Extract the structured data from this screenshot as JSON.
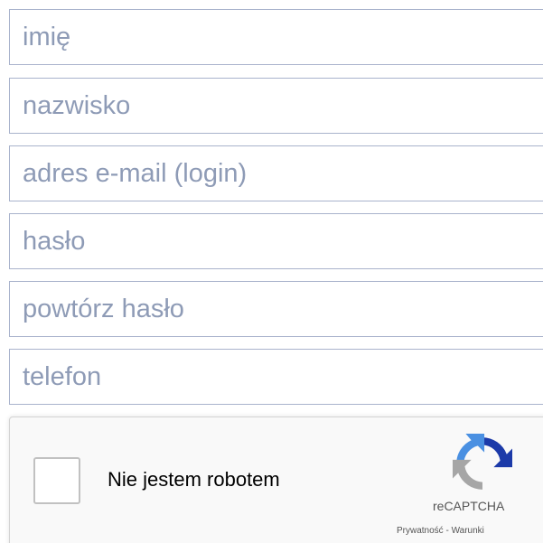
{
  "form": {
    "fields": [
      {
        "placeholder": "imię",
        "value": ""
      },
      {
        "placeholder": "nazwisko",
        "value": ""
      },
      {
        "placeholder": "adres e-mail (login)",
        "value": ""
      },
      {
        "placeholder": "hasło",
        "value": ""
      },
      {
        "placeholder": "powtórz hasło",
        "value": ""
      },
      {
        "placeholder": "telefon",
        "value": ""
      }
    ]
  },
  "captcha": {
    "label": "Nie jestem robotem",
    "checked": false,
    "brand": "reCAPTCHA",
    "privacy_link": "Prywatność",
    "separator": " - ",
    "terms_link": "Warunki",
    "logo_icon": "recaptcha-logo-icon",
    "colors": {
      "logo_blue": "#1c3aa9",
      "logo_light_blue": "#4a90e2",
      "logo_gray": "#a6a6a6"
    }
  }
}
